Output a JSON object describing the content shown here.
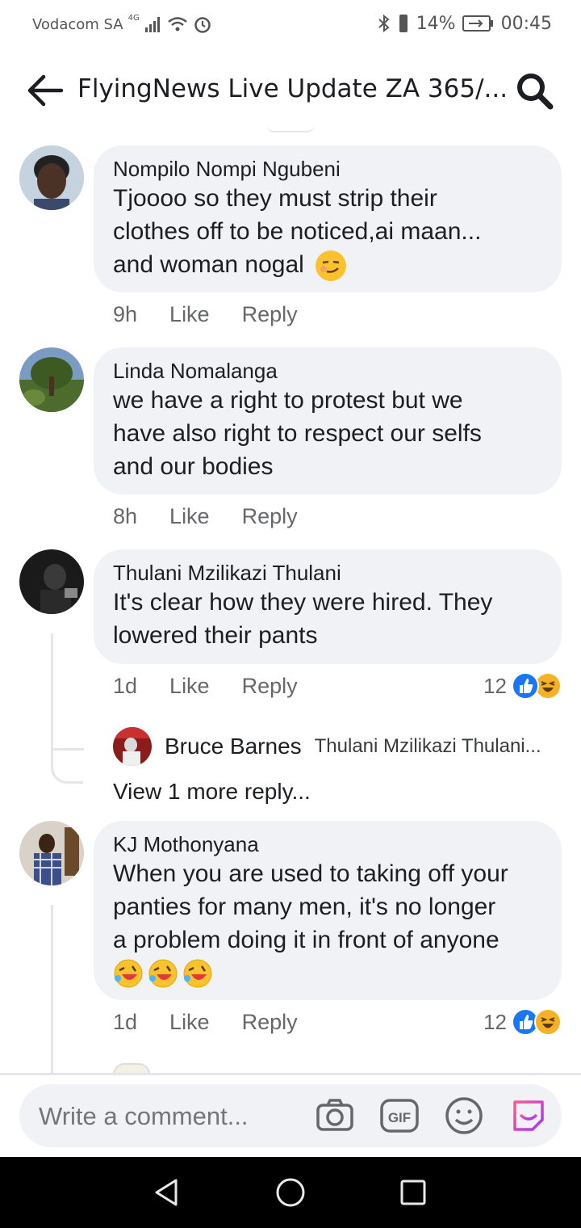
{
  "status_bar": {
    "carrier": "Vodacom SA",
    "network": "4G",
    "battery": "14%",
    "time": "00:45"
  },
  "header": {
    "title": "FlyingNews Live Update ZA 365/..."
  },
  "comments": [
    {
      "author": "Nompilo Nompi Ngubeni",
      "text_lines": [
        "Tjoooo so they must strip their",
        "clothes off to be noticed,ai maan...",
        "and woman nogal"
      ],
      "emoji": "smirk-emoji",
      "time": "9h",
      "like": "Like",
      "reply": "Reply"
    },
    {
      "author": "Linda Nomalanga",
      "text_lines": [
        "we have a right to protest but we",
        "have also right to respect our selfs",
        "and our bodies"
      ],
      "time": "8h",
      "like": "Like",
      "reply": "Reply"
    },
    {
      "author": "Thulani Mzilikazi Thulani",
      "text_lines": [
        "It's clear how they were hired. They",
        "lowered their pants"
      ],
      "time": "1d",
      "like": "Like",
      "reply": "Reply",
      "reaction_count": "12",
      "reactions": [
        "like-reaction-icon",
        "haha-reaction-icon"
      ],
      "reply_preview": {
        "author": "Bruce Barnes",
        "snippet": "Thulani Mzilikazi Thulani..."
      },
      "more_replies": "View 1 more reply..."
    },
    {
      "author": "KJ Mothonyana",
      "text_lines": [
        "When you are used to taking off your",
        "panties for many men, it's no longer",
        "a problem doing it in front of anyone"
      ],
      "emoji_run": [
        "rofl-emoji",
        "rofl-emoji",
        "rofl-emoji"
      ],
      "time": "1d",
      "like": "Like",
      "reply": "Reply",
      "reaction_count": "12",
      "reactions": [
        "like-reaction-icon",
        "haha-reaction-icon"
      ]
    }
  ],
  "composer": {
    "placeholder": "Write a comment...",
    "icons": [
      "camera-icon",
      "gif-icon",
      "emoji-icon",
      "sticker-icon"
    ]
  },
  "colors": {
    "bubble": "#f0f2f5",
    "meta_text": "#65676b",
    "like_blue": "#1877f2",
    "haha_yellow": "#f7b125",
    "sticker_purple": "#a033ff"
  }
}
